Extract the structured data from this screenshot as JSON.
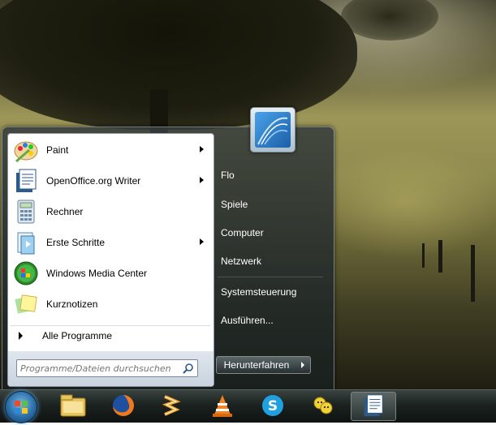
{
  "menu": {
    "programs": [
      {
        "label": "Paint",
        "icon": "paint-icon",
        "has_submenu": true
      },
      {
        "label": "OpenOffice.org Writer",
        "icon": "writer-icon",
        "has_submenu": true
      },
      {
        "label": "Rechner",
        "icon": "calculator-icon",
        "has_submenu": false
      },
      {
        "label": "Erste Schritte",
        "icon": "getting-started-icon",
        "has_submenu": true
      },
      {
        "label": "Windows Media Center",
        "icon": "media-center-icon",
        "has_submenu": false
      },
      {
        "label": "Kurznotizen",
        "icon": "sticky-notes-icon",
        "has_submenu": false
      }
    ],
    "all_programs": "Alle Programme",
    "search_placeholder": "Programme/Dateien durchsuchen",
    "right_items": [
      "Flo",
      "Spiele",
      "Computer",
      "Netzwerk",
      "Systemsteuerung",
      "Ausführen..."
    ],
    "shutdown_label": "Herunterfahren"
  },
  "taskbar": {
    "items": [
      "explorer-icon",
      "firefox-icon",
      "winamp-icon",
      "vlc-icon",
      "skype-icon",
      "messenger-icon",
      "writer-icon"
    ],
    "active_item": "writer-icon"
  },
  "colors": {
    "menu_frame": "#26302e",
    "left_pane": "#ffffff",
    "accent": "#2a6ea8"
  }
}
